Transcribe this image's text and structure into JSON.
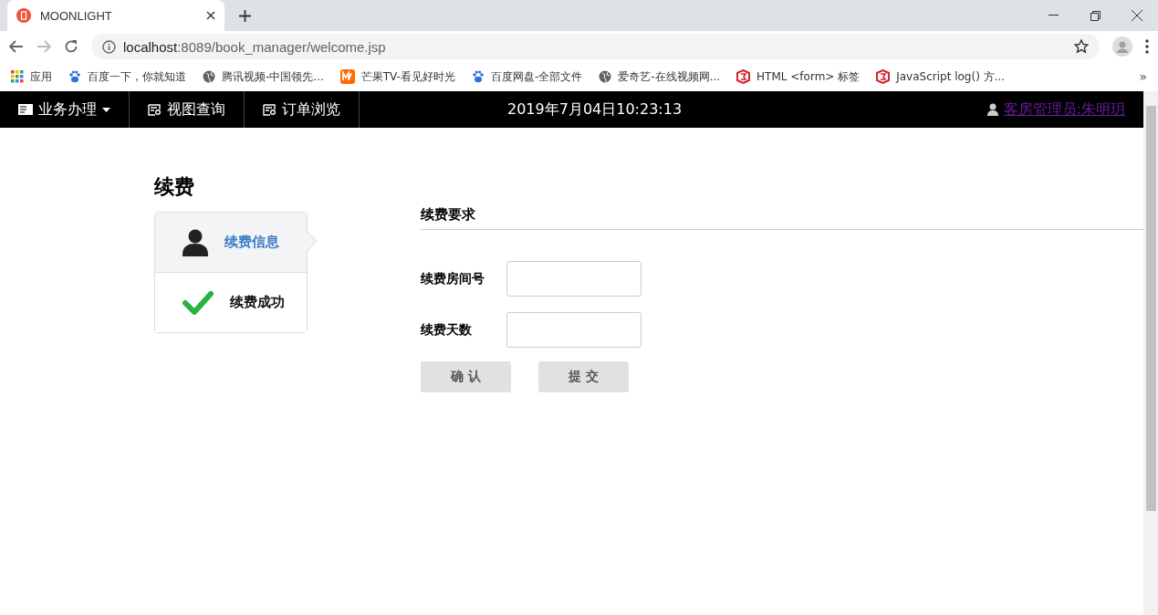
{
  "browser": {
    "tab_title": "MOONLIGHT",
    "url_host": "localhost",
    "url_path": ":8089/book_manager/welcome.jsp",
    "bookmarks": [
      {
        "label": "应用",
        "kind": "apps"
      },
      {
        "label": "百度一下，你就知道",
        "kind": "paw"
      },
      {
        "label": "腾讯视频-中国领先...",
        "kind": "globe"
      },
      {
        "label": "芒果TV-看见好时光",
        "kind": "mango"
      },
      {
        "label": "百度网盘-全部文件",
        "kind": "paw"
      },
      {
        "label": "爱奇艺-在线视频网...",
        "kind": "globe"
      },
      {
        "label": "HTML <form> 标签",
        "kind": "w3"
      },
      {
        "label": "JavaScript log() 方...",
        "kind": "w3"
      }
    ],
    "overflow": "»"
  },
  "navbar": {
    "items": [
      {
        "label": "业务办理",
        "kind": "dropdown"
      },
      {
        "label": "视图查询",
        "kind": "link"
      },
      {
        "label": "订单浏览",
        "kind": "link"
      }
    ],
    "datetime": "2019年7月04日10:23:13",
    "user": "客房管理员:朱明玥"
  },
  "page": {
    "title": "续费",
    "steps": [
      {
        "label": "续费信息",
        "kind": "user",
        "selected": true
      },
      {
        "label": "续费成功",
        "kind": "check",
        "selected": false
      }
    ],
    "section_title": "续费要求",
    "fields": [
      {
        "label": "续费房间号"
      },
      {
        "label": "续费天数"
      }
    ],
    "buttons": [
      "确 认",
      "提 交"
    ]
  }
}
